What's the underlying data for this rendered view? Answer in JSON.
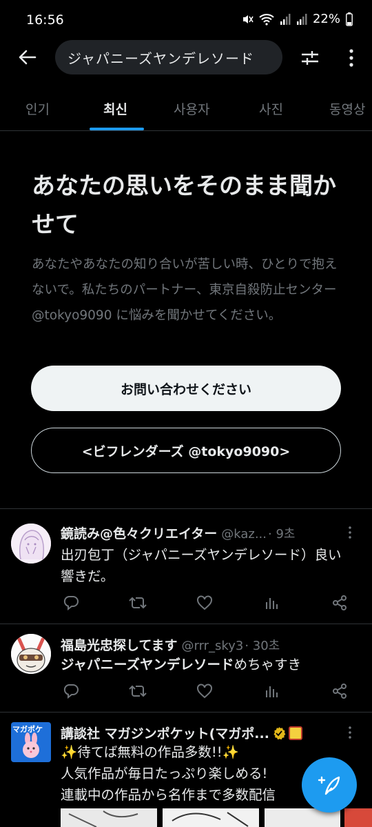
{
  "status_bar": {
    "time": "16:56",
    "battery": "22%"
  },
  "header": {
    "search_query": "ジャパニーズヤンデレソード"
  },
  "tabs": [
    {
      "label": "인기"
    },
    {
      "label": "최신"
    },
    {
      "label": "사용자"
    },
    {
      "label": "사진"
    },
    {
      "label": "동영상"
    }
  ],
  "notice": {
    "title": "あなたの思いをそのまま聞かせて",
    "body": "あなたやあなたの知り合いが苦しい時、ひとりで抱えないで。私たちのパートナー、東京自殺防止センター @tokyo9090 に悩みを聞かせてください。",
    "contact_button": "お問い合わせください",
    "befrienders_button": "<ビフレンダーズ @tokyo9090>"
  },
  "tweets": [
    {
      "name": "鏡読み@色々クリエイター",
      "handle": "@kaz...",
      "time": "· 9초",
      "text": "出刃包丁（ジャパニーズヤンデレソード）良い響きだ。"
    },
    {
      "name": "福島光忠探してます",
      "handle": "@rrr_sky3",
      "time": "· 30초",
      "text_bold": "ジャパニーズヤンデレソード",
      "text_rest": "めちゃすき"
    },
    {
      "name": "講談社 マガジンポケット(マガポ...",
      "avatar_text": "マガポケ",
      "lines": [
        "✨待てば無料の作品多数!!✨",
        "人気作品が毎日たっぷり楽しめる!",
        "連載中の作品から名作まで多数配信"
      ]
    }
  ],
  "colors": {
    "accent": "#1d9bf0",
    "background": "#000000",
    "muted": "#71767b"
  },
  "icons": [
    "back-arrow-icon",
    "filter-icon",
    "more-vertical-icon",
    "reply-icon",
    "retweet-icon",
    "like-icon",
    "views-icon",
    "share-icon",
    "compose-icon",
    "verified-icon"
  ]
}
